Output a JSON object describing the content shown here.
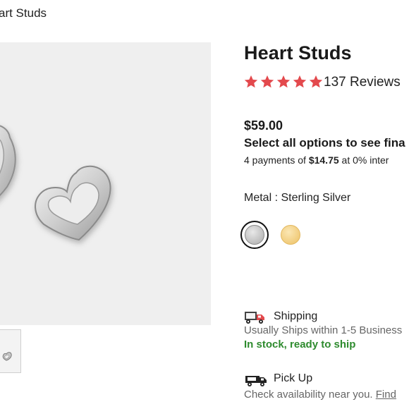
{
  "breadcrumb": {
    "current": "art Studs"
  },
  "product": {
    "title": "Heart Studs",
    "rating": {
      "stars": 5,
      "reviews_label": "137 Reviews"
    },
    "price": "$59.00",
    "select_message": "Select all options to see fina",
    "payments": {
      "prefix": "4 payments of ",
      "amount": "$14.75",
      "suffix": " at 0% inter"
    },
    "metal": {
      "label": "Metal : Sterling Silver",
      "options": [
        "Sterling Silver",
        "Gold"
      ],
      "selected": "Sterling Silver"
    }
  },
  "fulfillment": {
    "shipping": {
      "title": "Shipping",
      "subtitle": "Usually Ships within 1-5 Business",
      "stock": "In stock, ready to ship"
    },
    "pickup": {
      "title": "Pick Up",
      "subtitle": "Check availability near you. ",
      "link": "Find"
    }
  },
  "colors": {
    "star": "#e3494d",
    "stock": "#2e8b2e",
    "heart": "#e3494d"
  },
  "icons": [
    "heart-outline-icon",
    "star-icon",
    "shipping-truck-icon",
    "pickup-van-icon"
  ]
}
